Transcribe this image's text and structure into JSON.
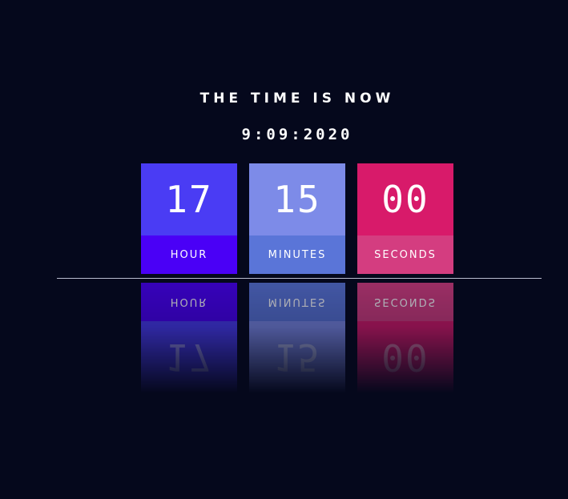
{
  "heading": "THE TIME IS NOW",
  "date": "9:09:2020",
  "tiles": [
    {
      "value": "17",
      "label": "HOUR",
      "top_color": "#4a3cf4",
      "bottom_color": "#4a00f6"
    },
    {
      "value": "15",
      "label": "MINUTES",
      "top_color": "#7d8be8",
      "bottom_color": "#5a75d8"
    },
    {
      "value": "00",
      "label": "SECONDS",
      "top_color": "#d81a6a",
      "bottom_color": "#d43d80"
    }
  ],
  "colors": {
    "background": "#05081c",
    "divider": "#b9bccf",
    "text": "#ffffff"
  }
}
